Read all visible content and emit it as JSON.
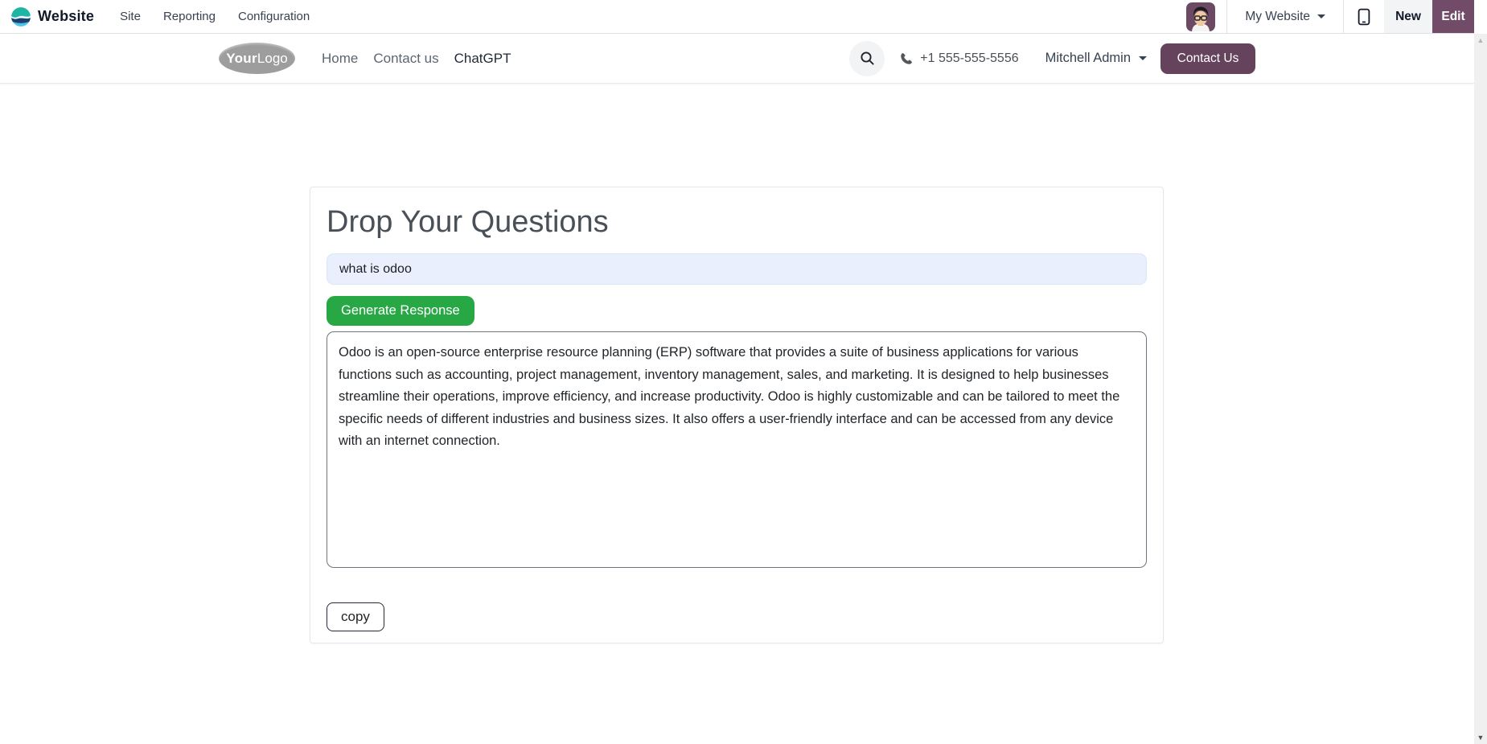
{
  "top_navbar": {
    "brand": "Website",
    "menus": [
      {
        "label": "Site"
      },
      {
        "label": "Reporting"
      },
      {
        "label": "Configuration"
      }
    ],
    "my_website_label": "My Website",
    "new_label": "New",
    "edit_label": "Edit"
  },
  "site_header": {
    "logo_bold": "Your",
    "logo_light": "Logo",
    "nav": [
      {
        "label": "Home",
        "active": false
      },
      {
        "label": "Contact us",
        "active": false
      },
      {
        "label": "ChatGPT",
        "active": true
      }
    ],
    "phone_number": "+1 555-555-5556",
    "user_name": "Mitchell Admin",
    "contact_button_label": "Contact Us"
  },
  "main": {
    "title": "Drop Your Questions",
    "question_input_value": "what is odoo",
    "generate_button_label": "Generate Response",
    "response_text": "Odoo is an open-source enterprise resource planning (ERP) software that provides a suite of business applications for various functions such as accounting, project management, inventory management, sales, and marketing. It is designed to help businesses streamline their operations, improve efficiency, and increase productivity. Odoo is highly customizable and can be tailored to meet the specific needs of different industries and business sizes. It also offers a user-friendly interface and can be accessed from any device with an internet connection.",
    "copy_button_label": "copy"
  },
  "colors": {
    "primary_purple": "#714B67",
    "contact_button_purple": "#65435C",
    "success_green": "#28a745",
    "input_bg": "#e9effc",
    "navbar_border": "#dee2e6"
  }
}
